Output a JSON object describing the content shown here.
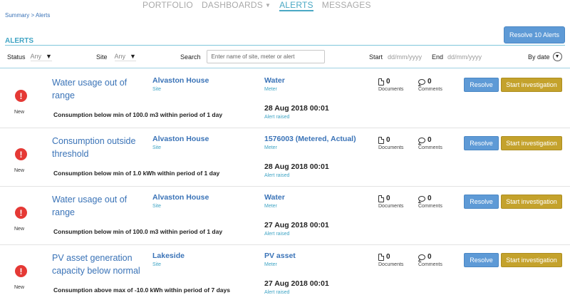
{
  "nav": {
    "items": [
      {
        "label": "PORTFOLIO"
      },
      {
        "label": "DASHBOARDS"
      },
      {
        "label": "ALERTS"
      },
      {
        "label": "MESSAGES"
      }
    ]
  },
  "breadcrumb": "Summary > Alerts",
  "page": {
    "title": "ALERTS",
    "resolve_all_label": "Resolve 10 Alerts"
  },
  "filters": {
    "status_label": "Status",
    "status_value": "Any",
    "site_label": "Site",
    "site_value": "Any",
    "search_label": "Search",
    "search_placeholder": "Enter name of site, meter or alert",
    "start_label": "Start",
    "start_placeholder": "dd/mm/yyyy",
    "end_label": "End",
    "end_placeholder": "dd/mm/yyyy",
    "sort_label": "By date"
  },
  "row_labels": {
    "site_sub": "Site",
    "meter_sub": "Meter",
    "documents": "Documents",
    "comments": "Comments",
    "resolve": "Resolve",
    "investigate": "Start investigation",
    "raised": "Alert raised"
  },
  "alerts": [
    {
      "status": "New",
      "title": "Water usage out of range",
      "site": "Alvaston House",
      "meter": "Water",
      "documents": "0",
      "comments": "0",
      "description": "Consumption below min of 100.0 m3 within period of 1 day",
      "raised": "28 Aug 2018 00:01"
    },
    {
      "status": "New",
      "title": "Consumption outside threshold",
      "site": "Alvaston House",
      "meter": "1576003 (Metered, Actual)",
      "documents": "0",
      "comments": "0",
      "description": "Consumption below min of 1.0 kWh within period of 1 day",
      "raised": "28 Aug 2018 00:01"
    },
    {
      "status": "New",
      "title": "Water usage out of range",
      "site": "Alvaston House",
      "meter": "Water",
      "documents": "0",
      "comments": "0",
      "description": "Consumption below min of 100.0 m3 within period of 1 day",
      "raised": "27 Aug 2018 00:01"
    },
    {
      "status": "New",
      "title": "PV asset generation capacity below normal",
      "site": "Lakeside",
      "meter": "PV asset",
      "documents": "0",
      "comments": "0",
      "description": "Consumption above max of -10.0 kWh within period of 7 days",
      "raised": "27 Aug 2018 00:01"
    }
  ]
}
